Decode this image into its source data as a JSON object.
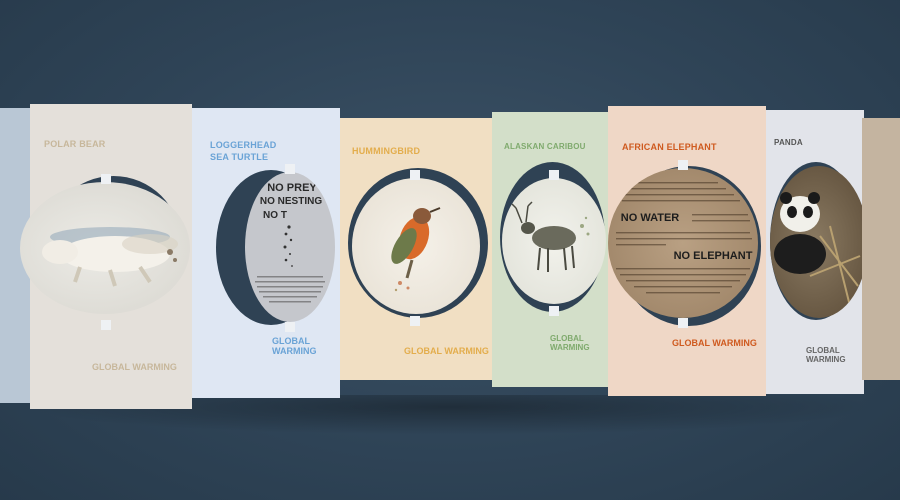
{
  "panels": {
    "polar_bear": {
      "title": "POLAR BEAR",
      "footer": "GLOBAL WARMING"
    },
    "sea_turtle": {
      "title_line1": "LOGGERHEAD",
      "title_line2": "SEA TURTLE",
      "footer": "GLOBAL WARMING",
      "disc_line1": "NO PREY",
      "disc_line2": "NO NESTING",
      "disc_line3": "NO T"
    },
    "hummingbird": {
      "title": "HUMMINGBIRD",
      "footer": "GLOBAL WARMING"
    },
    "caribou": {
      "title": "ALASKAN CARIBOU",
      "footer": "GLOBAL WARMING"
    },
    "elephant": {
      "title": "AFRICAN ELEPHANT",
      "footer": "GLOBAL WARMING",
      "disc_line1": "NO WATER",
      "disc_line2": "NO ELEPHANT"
    },
    "panda": {
      "title": "PANDA",
      "footer": "GLOBAL WARMING"
    }
  },
  "colors": {
    "polar_bear_panel": "#e3dfd9",
    "sea_turtle_panel": "#dfe7f3",
    "hummingbird_panel": "#f1dfc3",
    "caribou_panel": "#d3dfc9",
    "elephant_panel": "#efd7c6",
    "panda_panel": "#e2e4ea",
    "background": "#2f4457"
  }
}
